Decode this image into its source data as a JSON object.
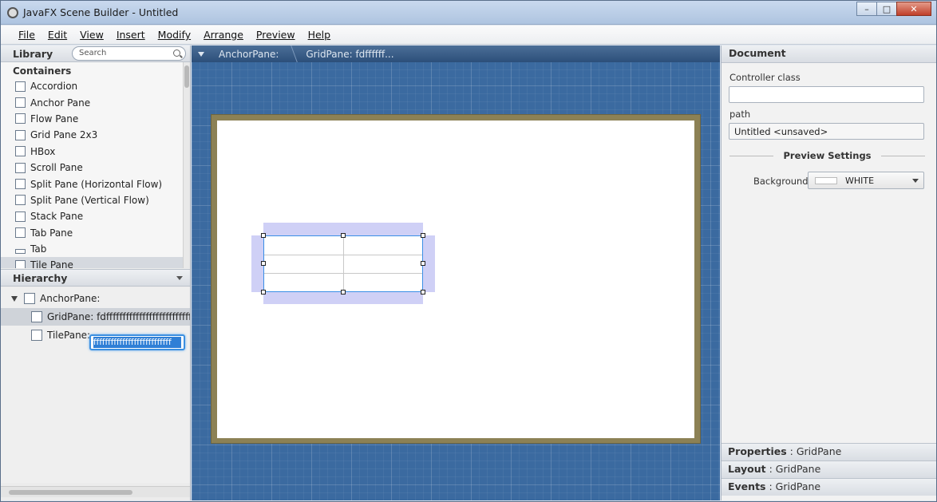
{
  "window": {
    "title": "JavaFX Scene Builder - Untitled",
    "min": "–",
    "max": "□",
    "close": "✕"
  },
  "menu": [
    "File",
    "Edit",
    "View",
    "Insert",
    "Modify",
    "Arrange",
    "Preview",
    "Help"
  ],
  "library": {
    "title": "Library",
    "search_placeholder": "Search",
    "category": "Containers",
    "items": [
      "Accordion",
      "Anchor Pane",
      "Flow Pane",
      "Grid Pane 2x3",
      "HBox",
      "Scroll Pane",
      "Split Pane (Horizontal Flow)",
      "Split Pane (Vertical Flow)",
      "Stack Pane",
      "Tab Pane",
      "Tab",
      "Tile Pane"
    ]
  },
  "hierarchy": {
    "title": "Hierarchy",
    "rows": [
      "AnchorPane:",
      "GridPane: fdffffffffffffffffffffffffffff",
      "TilePane:"
    ],
    "edit_value": "fffffffffffffffffffffffffff"
  },
  "breadcrumb": [
    "AnchorPane:",
    "GridPane: fdffffff..."
  ],
  "document": {
    "title": "Document",
    "controller_label": "Controller class",
    "controller_value": "",
    "path_label": "path",
    "path_value": "Untitled <unsaved>",
    "preview_settings": "Preview Settings",
    "background_label": "Background",
    "background_value": "WHITE"
  },
  "inspector": {
    "properties": "Properties",
    "layout": "Layout",
    "events": "Events",
    "selection": " : GridPane"
  },
  "colors": {
    "canvas_bg": "#3b6aa0",
    "stage_border": "#8c8155",
    "selection": "#3a8fe6"
  }
}
